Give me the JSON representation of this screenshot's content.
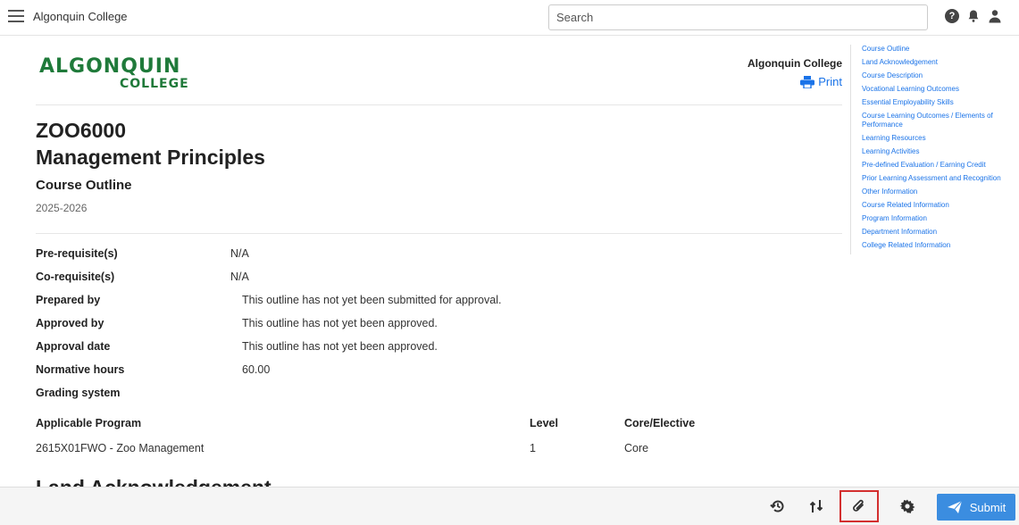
{
  "topbar": {
    "title": "Algonquin College",
    "search_placeholder": "Search",
    "help_glyph": "?"
  },
  "header": {
    "logo_top": "ALGONQUIN",
    "logo_bottom": "COLLEGE",
    "college_name": "Algonquin College",
    "print_label": "Print"
  },
  "course": {
    "code": "ZOO6000",
    "name": "Management Principles",
    "doc_type": "Course Outline",
    "year": "2025-2026"
  },
  "info": [
    {
      "label": "Pre-requisite(s)",
      "value": "N/A"
    },
    {
      "label": "Co-requisite(s)",
      "value": "N/A"
    },
    {
      "label": "Prepared by",
      "value": "This outline has not yet been submitted for approval."
    },
    {
      "label": "Approved by",
      "value": "This outline has not yet been approved."
    },
    {
      "label": "Approval date",
      "value": "This outline has not yet been approved."
    },
    {
      "label": "Normative hours",
      "value": "60.00"
    },
    {
      "label": "Grading system",
      "value": ""
    }
  ],
  "programs": {
    "headers": [
      "Applicable Program",
      "Level",
      "Core/Elective"
    ],
    "rows": [
      [
        "2615X01FWO - Zoo Management",
        "1",
        "Core"
      ]
    ]
  },
  "next_section": "Land Acknowledgement",
  "toc": [
    "Course Outline",
    "Land Acknowledgement",
    "Course Description",
    "Vocational Learning Outcomes",
    "Essential Employability Skills",
    "Course Learning Outcomes / Elements of Performance",
    "Learning Resources",
    "Learning Activities",
    "Pre-defined Evaluation / Earning Credit",
    "Prior Learning Assessment and Recognition",
    "Other Information",
    "Course Related Information",
    "Program Information",
    "Department Information",
    "College Related Information"
  ],
  "bottombar": {
    "submit_label": "Submit"
  },
  "colors": {
    "brand_green": "#1f7a3a",
    "link_blue": "#1a73e8",
    "submit_blue": "#3b8de0",
    "highlight_red": "#d32f2f"
  }
}
